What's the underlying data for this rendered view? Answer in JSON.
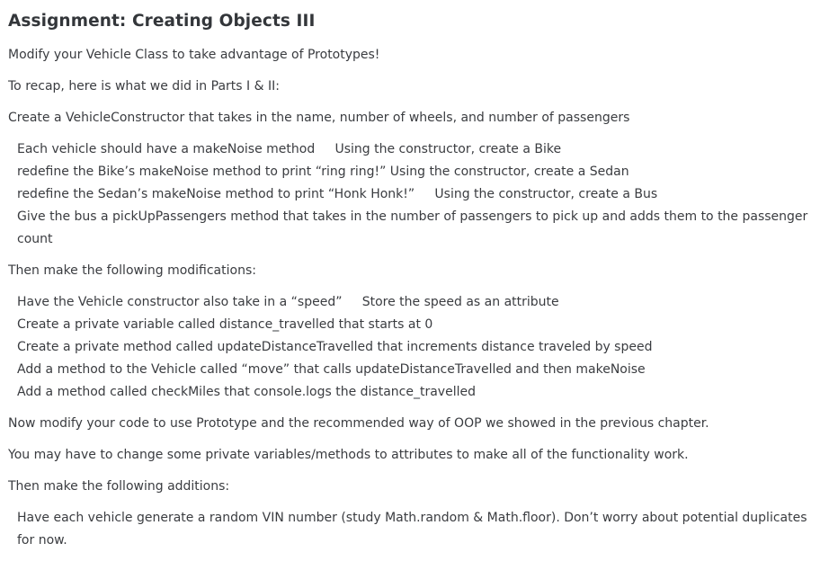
{
  "title": "Assignment: Creating Objects III",
  "intro": "Modify your Vehicle Class to take advantage of Prototypes!",
  "recap": "To recap, here is what we did in Parts I & II:",
  "create_constructor": "Create a VehicleConstructor that takes in the name, number of wheels, and number of passengers",
  "parts_list": [
    "Each vehicle should have a makeNoise method     Using the constructor, create a Bike",
    "redefine the Bike’s makeNoise method to print “ring ring!” Using the constructor, create a Sedan",
    "redefine the Sedan’s makeNoise method to print “Honk Honk!”     Using the constructor, create a Bus",
    "Give the bus a pickUpPassengers method that takes in the number of passengers to pick up and adds them to the passenger count"
  ],
  "modifications_heading": "Then make the following modifications:",
  "modifications_list": [
    "Have the Vehicle constructor also take in a “speed”     Store the speed as an attribute",
    "Create a private variable called distance_travelled that starts at 0",
    "Create a private method called updateDistanceTravelled that increments distance traveled by speed",
    "Add a method to the Vehicle called “move” that calls updateDistanceTravelled and then makeNoise",
    "Add a method called checkMiles that console.logs the distance_travelled"
  ],
  "prototype_text": "Now modify your code to use Prototype and the recommended way of OOP we showed in the previous chapter.",
  "private_text": "You may have to change some private variables/methods to attributes to make all of the functionality work.",
  "additions_heading": "Then make the following additions:",
  "additions_list": [
    "Have each vehicle generate a random VIN number (study Math.random & Math.floor). Don’t worry about potential duplicates for now."
  ]
}
